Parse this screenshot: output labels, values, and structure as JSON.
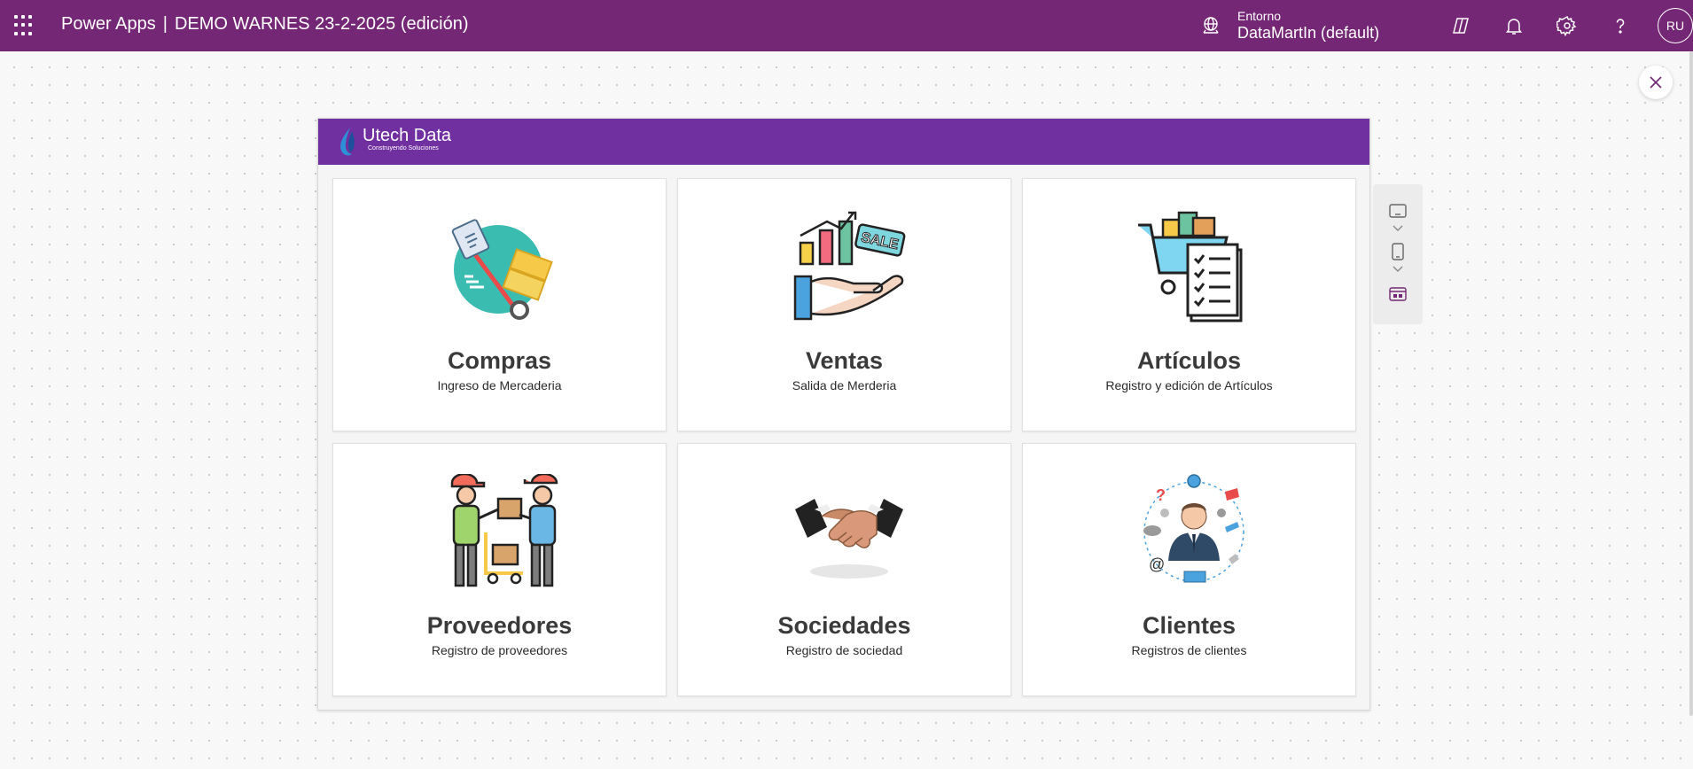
{
  "topbar": {
    "product": "Power Apps",
    "separator": "|",
    "app_name": "DEMO WARNES 23-2-2025 (edición)",
    "environment_label": "Entorno",
    "environment_value": "DataMartIn (default)",
    "avatar_initials": "RU",
    "icons": [
      "waffle-icon",
      "environment-icon",
      "copilot-icon",
      "bell-icon",
      "gear-icon",
      "help-icon"
    ]
  },
  "app": {
    "logo_title": "Utech Data",
    "logo_tagline": "Construyendo Soluciones",
    "header_color": "#7030a0"
  },
  "cards": [
    {
      "title": "Compras",
      "subtitle": "Ingreso de Mercaderia",
      "icon": "delivery-trolley-icon"
    },
    {
      "title": "Ventas",
      "subtitle": "Salida de Merderia",
      "icon": "sale-hand-chart-icon"
    },
    {
      "title": "Artículos",
      "subtitle": "Registro y edición de Artículos",
      "icon": "cart-checklist-icon"
    },
    {
      "title": "Proveedores",
      "subtitle": "Registro de proveedores",
      "icon": "delivery-workers-icon"
    },
    {
      "title": "Sociedades",
      "subtitle": "Registro de sociedad",
      "icon": "handshake-icon"
    },
    {
      "title": "Clientes",
      "subtitle": "Registros de clientes",
      "icon": "businessman-network-icon"
    }
  ],
  "colors": {
    "topbar": "#742774",
    "accent": "#7030a0"
  }
}
